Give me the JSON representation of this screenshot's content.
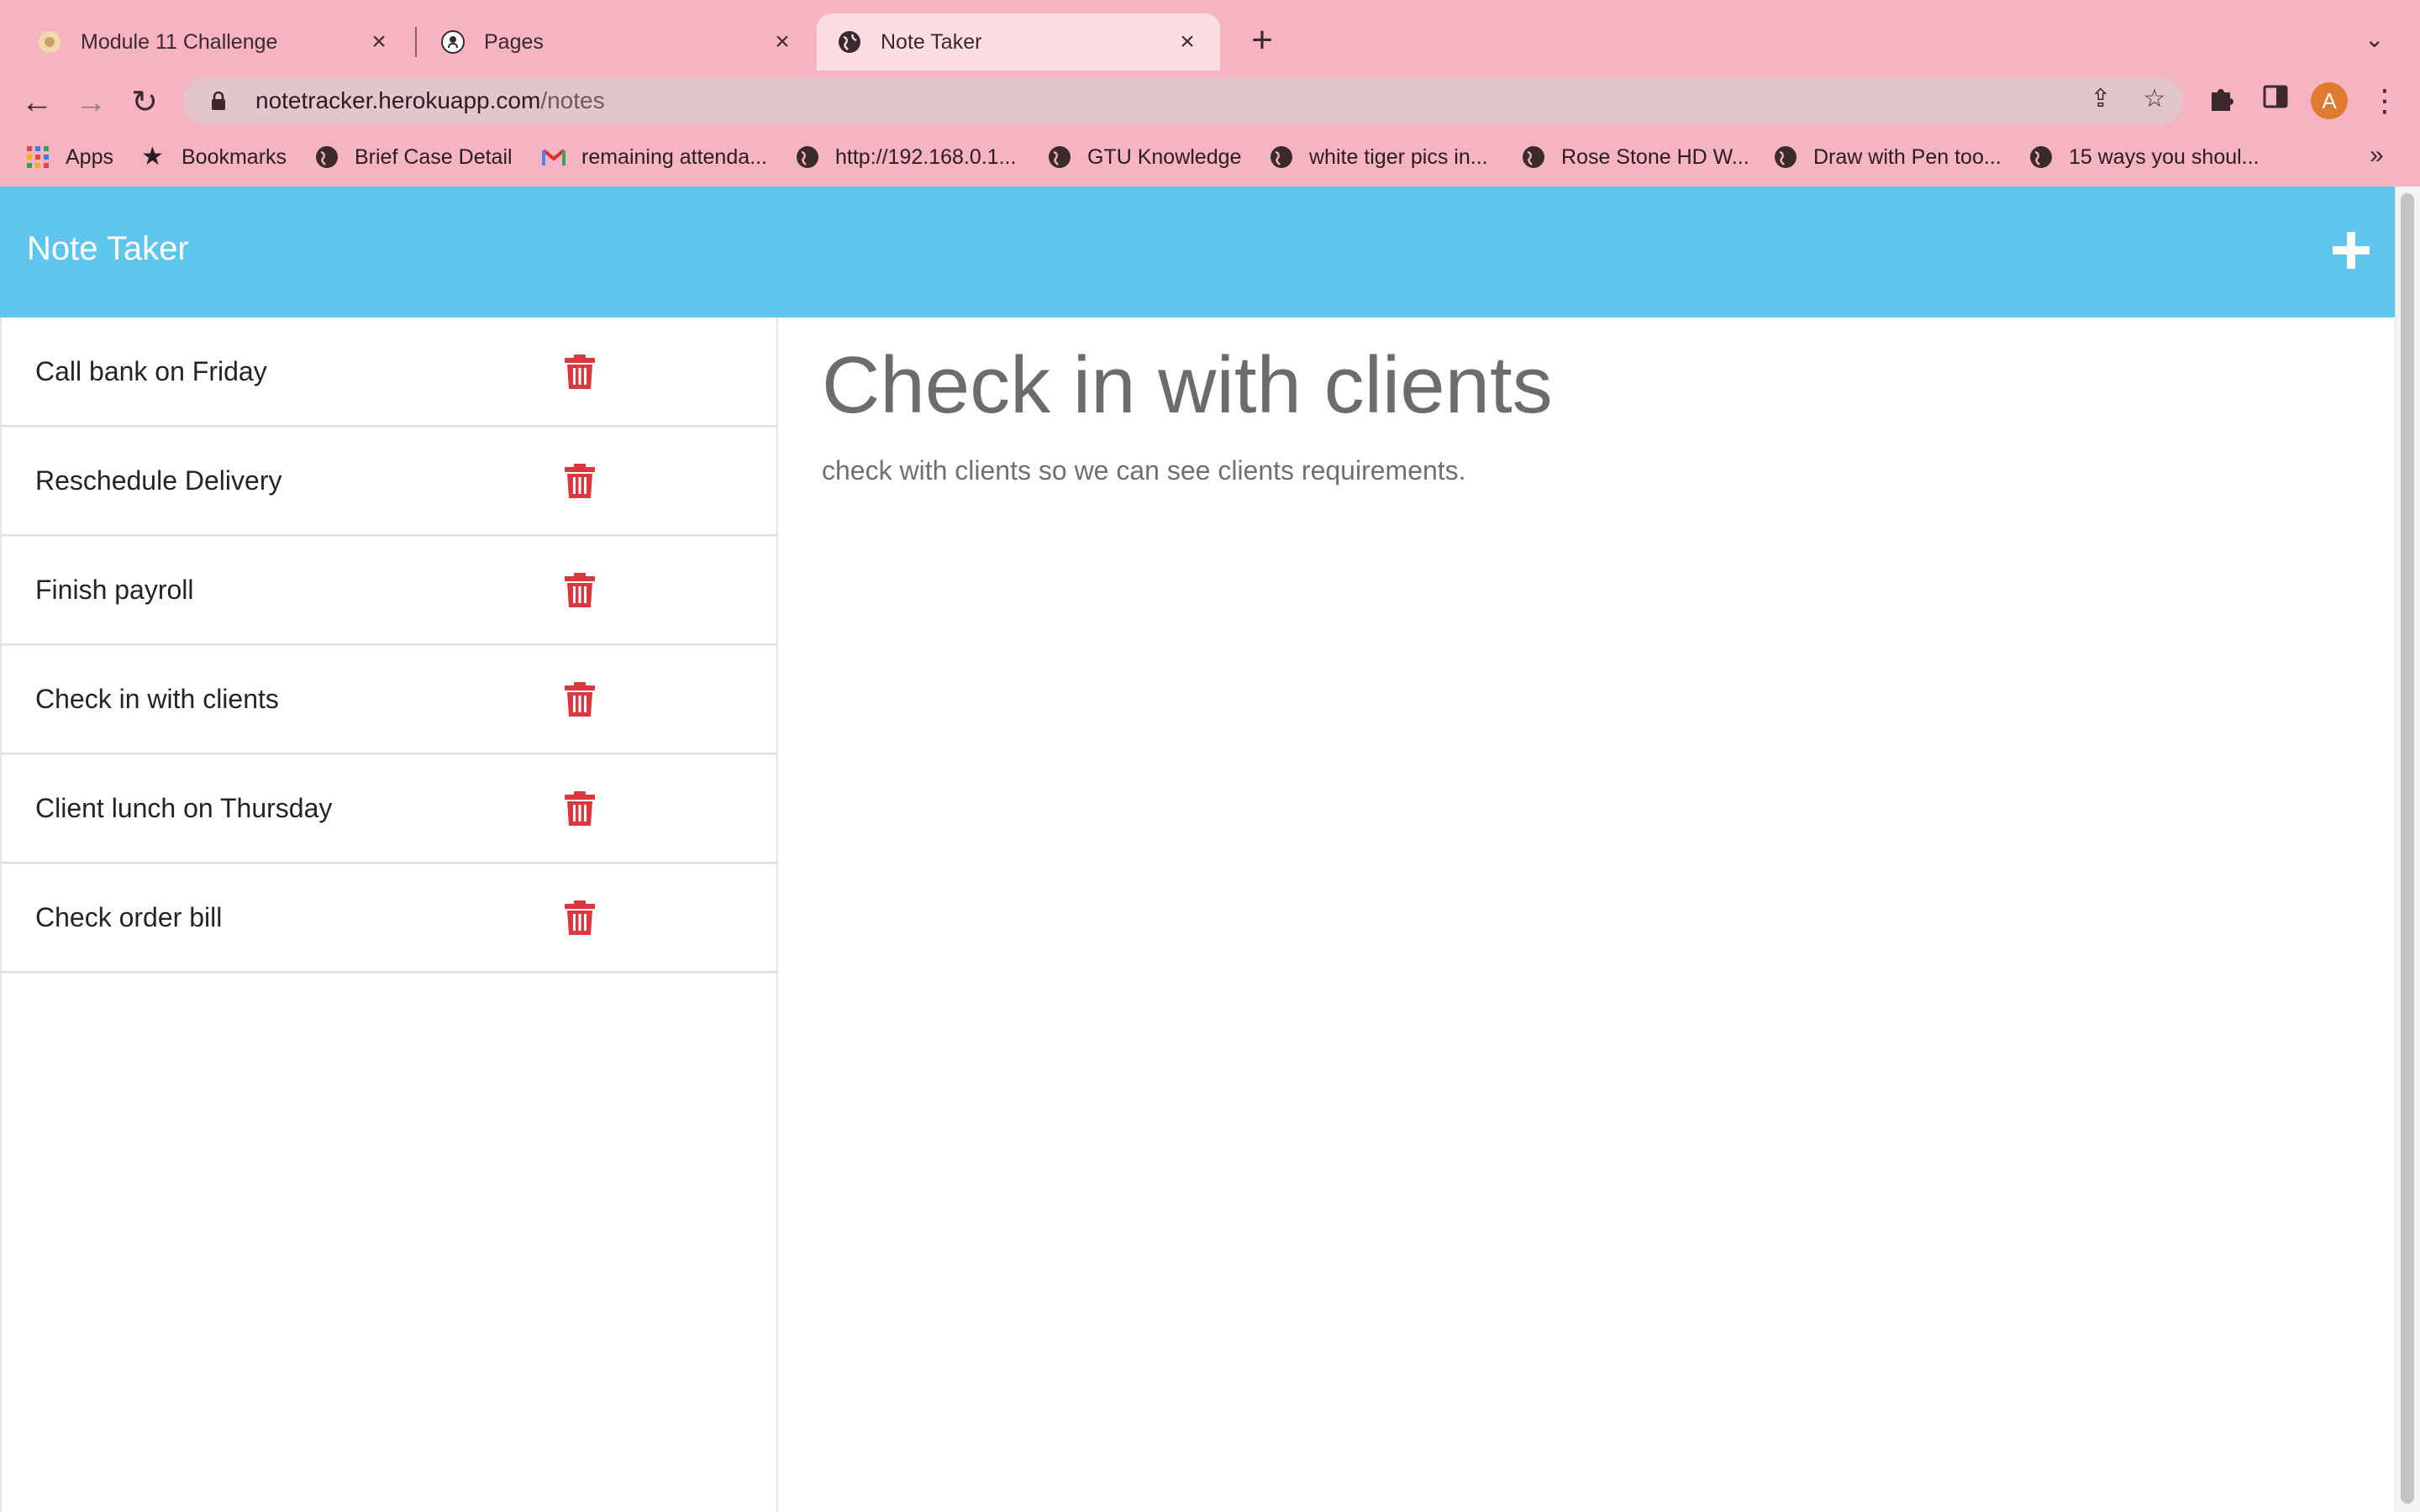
{
  "browser": {
    "tabs": [
      {
        "title": "Module 11 Challenge",
        "icon": "flower-favicon",
        "active": false
      },
      {
        "title": "Pages",
        "icon": "github-icon",
        "active": false
      },
      {
        "title": "Note Taker",
        "icon": "globe-icon",
        "active": true
      }
    ],
    "url_host": "notetracker.herokuapp.com",
    "url_path": "/notes",
    "profile_initial": "A",
    "bookmarks": [
      {
        "label": "Apps",
        "icon": "apps-grid-icon"
      },
      {
        "label": "Bookmarks",
        "icon": "star-icon"
      },
      {
        "label": "Brief Case Detail",
        "icon": "globe-icon"
      },
      {
        "label": "remaining attenda...",
        "icon": "gmail-icon"
      },
      {
        "label": "http://192.168.0.1...",
        "icon": "globe-icon"
      },
      {
        "label": "GTU Knowledge",
        "icon": "globe-icon"
      },
      {
        "label": "white tiger pics in...",
        "icon": "globe-icon"
      },
      {
        "label": "Rose Stone HD W...",
        "icon": "globe-icon"
      },
      {
        "label": "Draw with Pen too...",
        "icon": "globe-icon"
      },
      {
        "label": "15 ways you shoul...",
        "icon": "globe-icon"
      }
    ],
    "bookmarks_overflow": "»"
  },
  "app": {
    "brand": "Note Taker",
    "notes": [
      {
        "title": "Call bank on Friday"
      },
      {
        "title": "Reschedule Delivery"
      },
      {
        "title": "Finish payroll"
      },
      {
        "title": "Check in with clients"
      },
      {
        "title": "Client lunch on Thursday"
      },
      {
        "title": "Check order bill"
      }
    ],
    "active_note": {
      "title": "Check in with clients",
      "text": "check with clients so we can see clients requirements."
    }
  },
  "colors": {
    "chrome_bg": "#f6b3c1",
    "header_bg": "#5ec6ec",
    "trash_red": "#d9383e"
  }
}
